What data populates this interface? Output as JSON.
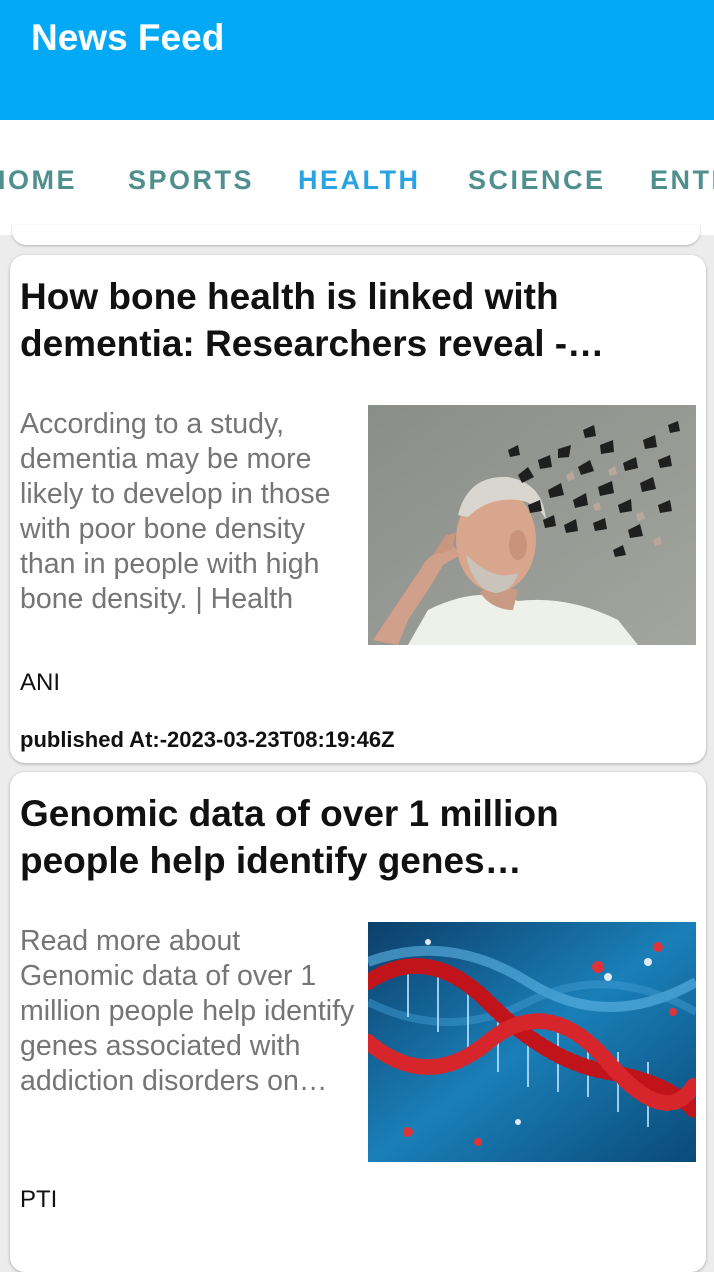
{
  "appbar": {
    "title": "News Feed",
    "color": "#03a9f4"
  },
  "tabs": [
    {
      "label": "HOME",
      "active": false
    },
    {
      "label": "SPORTS",
      "active": false
    },
    {
      "label": "HEALTH",
      "active": true
    },
    {
      "label": "SCIENCE",
      "active": false
    },
    {
      "label": "ENTERTAINMENT",
      "active": false
    }
  ],
  "articles": [
    {
      "title": "How bone health is linked with dementia: Researchers reveal -…",
      "description": "According to a study, dementia may be more likely to develop in those with poor bone density than in people with high bone density. | Health",
      "source": "ANI",
      "published": "published At:-2023-03-23T08:19:46Z",
      "image_icon": "man-dementia-image"
    },
    {
      "title": "Genomic data of over 1 million people help identify genes…",
      "description": "Read more about Genomic data of over 1 million people help identify genes associated with addiction disorders on…",
      "source": "PTI",
      "image_icon": "dna-helix-image"
    }
  ]
}
